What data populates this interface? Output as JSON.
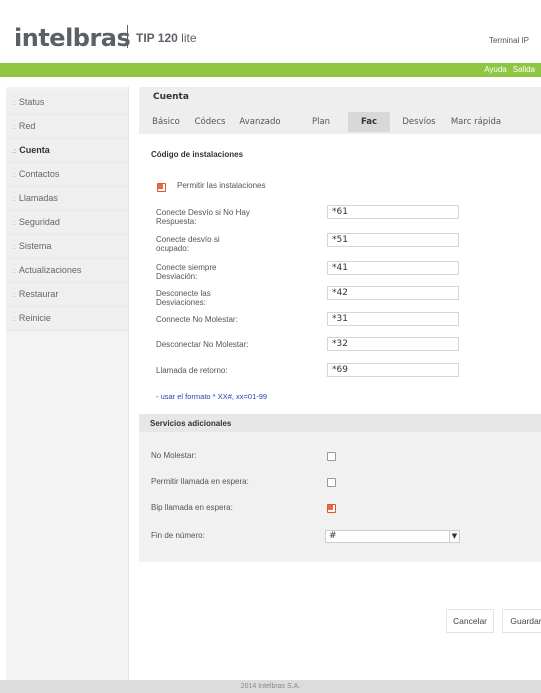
{
  "header": {
    "brand": "intelbras",
    "product_bold": "TIP 120",
    "product_light": " lite",
    "device": "Terminal IP",
    "links": [
      "Ayuda",
      "Salida"
    ]
  },
  "sidebar": {
    "items": [
      {
        "label": "Status"
      },
      {
        "label": "Red"
      },
      {
        "label": "Cuenta",
        "active": true
      },
      {
        "label": "Contactos"
      },
      {
        "label": "Llamadas"
      },
      {
        "label": "Seguridad"
      },
      {
        "label": "Sistema"
      },
      {
        "label": "Actualizaciones"
      },
      {
        "label": "Restaurar"
      },
      {
        "label": "Reinicie"
      }
    ]
  },
  "main": {
    "title": "Cuenta",
    "tabs": [
      {
        "label": "Básico"
      },
      {
        "label": "Códecs"
      },
      {
        "label": "Avanzado"
      },
      {
        "label": "Plan"
      },
      {
        "label": "Fac",
        "active": true
      },
      {
        "label": "Desvíos"
      },
      {
        "label": "Marc rápida"
      }
    ],
    "section_title": "Código de instalaciones",
    "allow_label": "Permitir las instalaciones",
    "allow_checked": true,
    "codes": [
      {
        "label": "Conecte Desvío si No Hay Respuesta:",
        "value": "*61"
      },
      {
        "label": "Conecte desvío si ocupado:",
        "value": "*51"
      },
      {
        "label": "Conecte siempre Desviación:",
        "value": "*41"
      },
      {
        "label": "Desconecte las Desviaciones:",
        "value": "*42"
      },
      {
        "label": "Connecte No Molestar:",
        "value": "*31"
      },
      {
        "label": "Desconectar No Molestar:",
        "value": "*32"
      },
      {
        "label": "Llamada de retorno:",
        "value": "*69"
      }
    ],
    "hint": "- usar el formato * XX#, xx=01-99",
    "additional": {
      "title": "Servicios adicionales",
      "items": [
        {
          "label": "No Molestar:",
          "checked": false
        },
        {
          "label": "Permitir llamada en espera:",
          "checked": false
        },
        {
          "label": "Bip llamada en espera:",
          "checked": true
        }
      ],
      "end_label": "Fin de número:",
      "end_value": "#"
    },
    "buttons": {
      "cancel": "Cancelar",
      "save": "Guardar"
    }
  },
  "footer": "2014 Intelbras S.A.",
  "colors": {
    "accent_green": "#8ec641",
    "checkbox_checked": "#e9694a",
    "hint_blue": "#2a3fb6"
  }
}
